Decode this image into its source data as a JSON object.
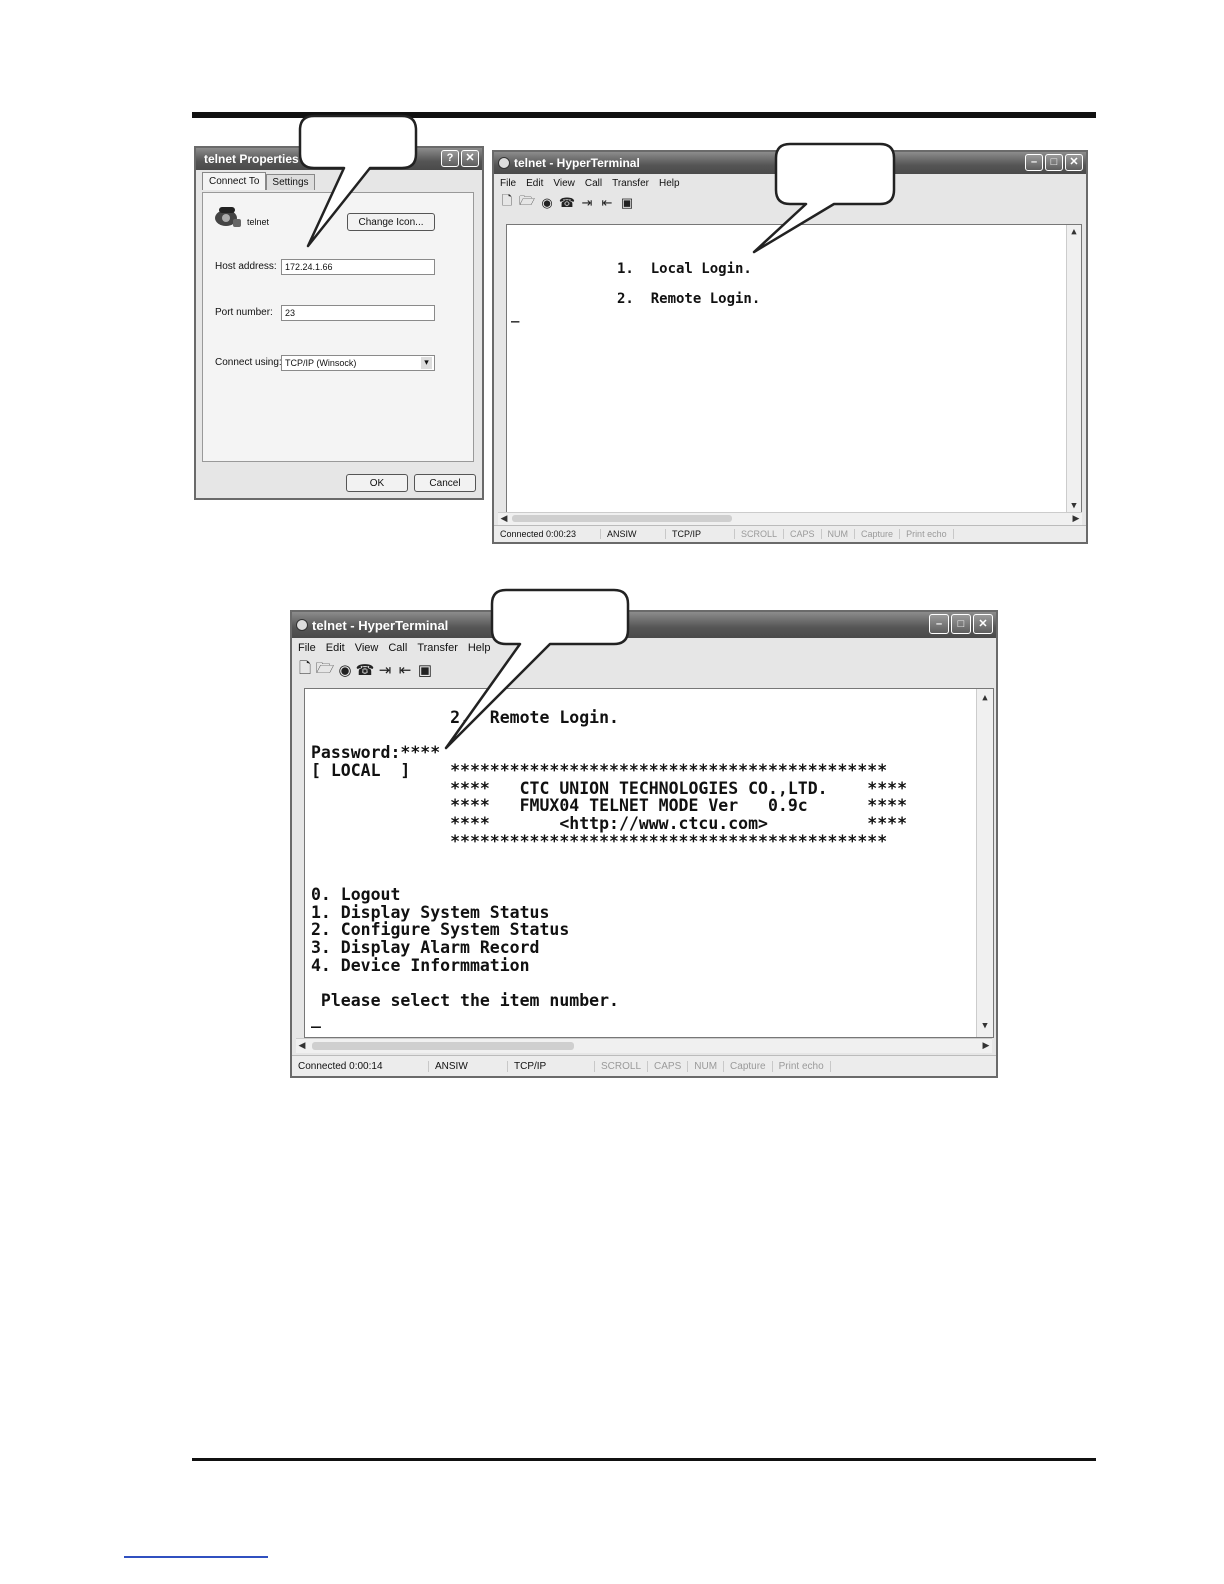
{
  "dialog": {
    "title": "telnet Properties",
    "help_btn": "?",
    "close_btn": "✕",
    "tabs": [
      "Connect To",
      "Settings"
    ],
    "connection_name": "telnet",
    "change_icon_label": "Change Icon...",
    "host_label": "Host address:",
    "host_value": "172.24.1.66",
    "port_label": "Port number:",
    "port_value": "23",
    "connect_label": "Connect using:",
    "connect_value": "TCP/IP (Winsock)",
    "ok_label": "OK",
    "cancel_label": "Cancel"
  },
  "ht1": {
    "title": "telnet - HyperTerminal",
    "menu": [
      "File",
      "Edit",
      "View",
      "Call",
      "Transfer",
      "Help"
    ],
    "terminal_lines": [
      "1.  Local Login.",
      "2.  Remote Login."
    ],
    "cursor": "_",
    "status": {
      "connected": "Connected 0:00:23",
      "emulation": "ANSIW",
      "protocol": "TCP/IP",
      "scroll": "SCROLL",
      "caps": "CAPS",
      "num": "NUM",
      "capture": "Capture",
      "print_echo": "Print echo"
    }
  },
  "ht2": {
    "title": "telnet - HyperTerminal",
    "menu": [
      "File",
      "Edit",
      "View",
      "Call",
      "Transfer",
      "Help"
    ],
    "terminal_lines": [
      "              2.  Remote Login.",
      "",
      "Password:****",
      "[ LOCAL  ]    ********************************************",
      "              ****   CTC UNION TECHNOLOGIES CO.,LTD.    ****",
      "              ****   FMUX04 TELNET MODE Ver   0.9c      ****",
      "              ****       <http://www.ctcu.com>          ****",
      "              ********************************************",
      "",
      "",
      "0. Logout",
      "1. Display System Status",
      "2. Configure System Status",
      "3. Display Alarm Record",
      "4. Device Informmation",
      "",
      " Please select the item number.",
      "_"
    ],
    "status": {
      "connected": "Connected 0:00:14",
      "emulation": "ANSIW",
      "protocol": "TCP/IP",
      "scroll": "SCROLL",
      "caps": "CAPS",
      "num": "NUM",
      "capture": "Capture",
      "print_echo": "Print echo"
    }
  },
  "icons": {
    "window_min": "–",
    "window_max": "□",
    "window_close": "✕",
    "scroll_up": "▲",
    "scroll_down": "▼",
    "scroll_left": "◀",
    "scroll_right": "▶",
    "dropdown": "▾"
  }
}
